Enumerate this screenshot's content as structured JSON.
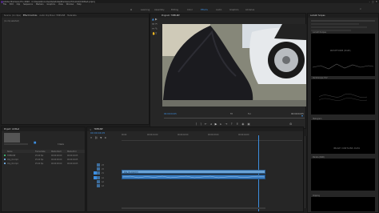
{
  "titlebar": {
    "title": "Adobe Premiere Pro 2020 - C:\\Users\\Documents\\Adobe\\Premiere Pro\\14.0\\Untitled.prproj"
  },
  "menu": [
    "File",
    "Edit",
    "Clip",
    "Sequence",
    "Markers",
    "Graphics",
    "View",
    "Window",
    "Help"
  ],
  "workspaces": [
    "Learning",
    "Assembly",
    "Editing",
    "Color",
    "Effects",
    "Audio",
    "Graphics",
    "Libraries"
  ],
  "source": {
    "tabs": [
      "Source: (no clips)",
      "Effect Controls",
      "Audio Clip Mixer: TIMELINE",
      "Metadata"
    ],
    "placeholder": "(no clip selected)"
  },
  "program": {
    "tab": "Program: TIMELINE",
    "timecode": "00:00:04:05",
    "fit": "Fit",
    "quality": "Full",
    "duration": "00:00:04:05"
  },
  "effects": {
    "header": "Lumetri Scopes",
    "scopes": [
      {
        "label": "Lumetri Scopes",
        "caption": "WAVEFORM (RGB)"
      },
      {
        "label": "Vectorscope YUV",
        "caption": ""
      },
      {
        "label": "Histogram",
        "caption": "IMAGE CONTAINS DATA"
      },
      {
        "label": "Parade (RGB)",
        "caption": ""
      },
      {
        "label": "Clipping",
        "caption": ""
      }
    ]
  },
  "project": {
    "tab": "Project: Untitled",
    "search_placeholder": "Search",
    "items_count": "3 Items",
    "columns": [
      "Name",
      "Frame Rate",
      "Media Start",
      "Media End"
    ],
    "rows": [
      {
        "name": "TIMELINE",
        "fps": "25.00 fps",
        "start": "00:00:00:00",
        "end": "00:00:04:05"
      },
      {
        "name": "Clip_01.mp4",
        "fps": "25.00 fps",
        "start": "00:00:00:00",
        "end": "00:00:04:05"
      },
      {
        "name": "Clip_02.mp4",
        "fps": "25.00 fps",
        "start": "00:00:00:00",
        "end": "00:00:04:05"
      }
    ]
  },
  "timeline": {
    "tab": "TIMELINE",
    "timecode": "00:00:04:05",
    "ruler": [
      "00:00",
      "00:00:01:00",
      "00:00:02:00",
      "00:00:03:00",
      "00:00:04:00"
    ],
    "tracks": [
      "V3",
      "V2",
      "V1",
      "A1",
      "A2",
      "A3"
    ],
    "video_clip": "Clip_01.mp4 [V]",
    "audio_clip": ""
  },
  "colors": {
    "accent": "#3d8ee0",
    "clip_video": "#6aa3d5",
    "clip_audio": "#3c7ec1"
  }
}
